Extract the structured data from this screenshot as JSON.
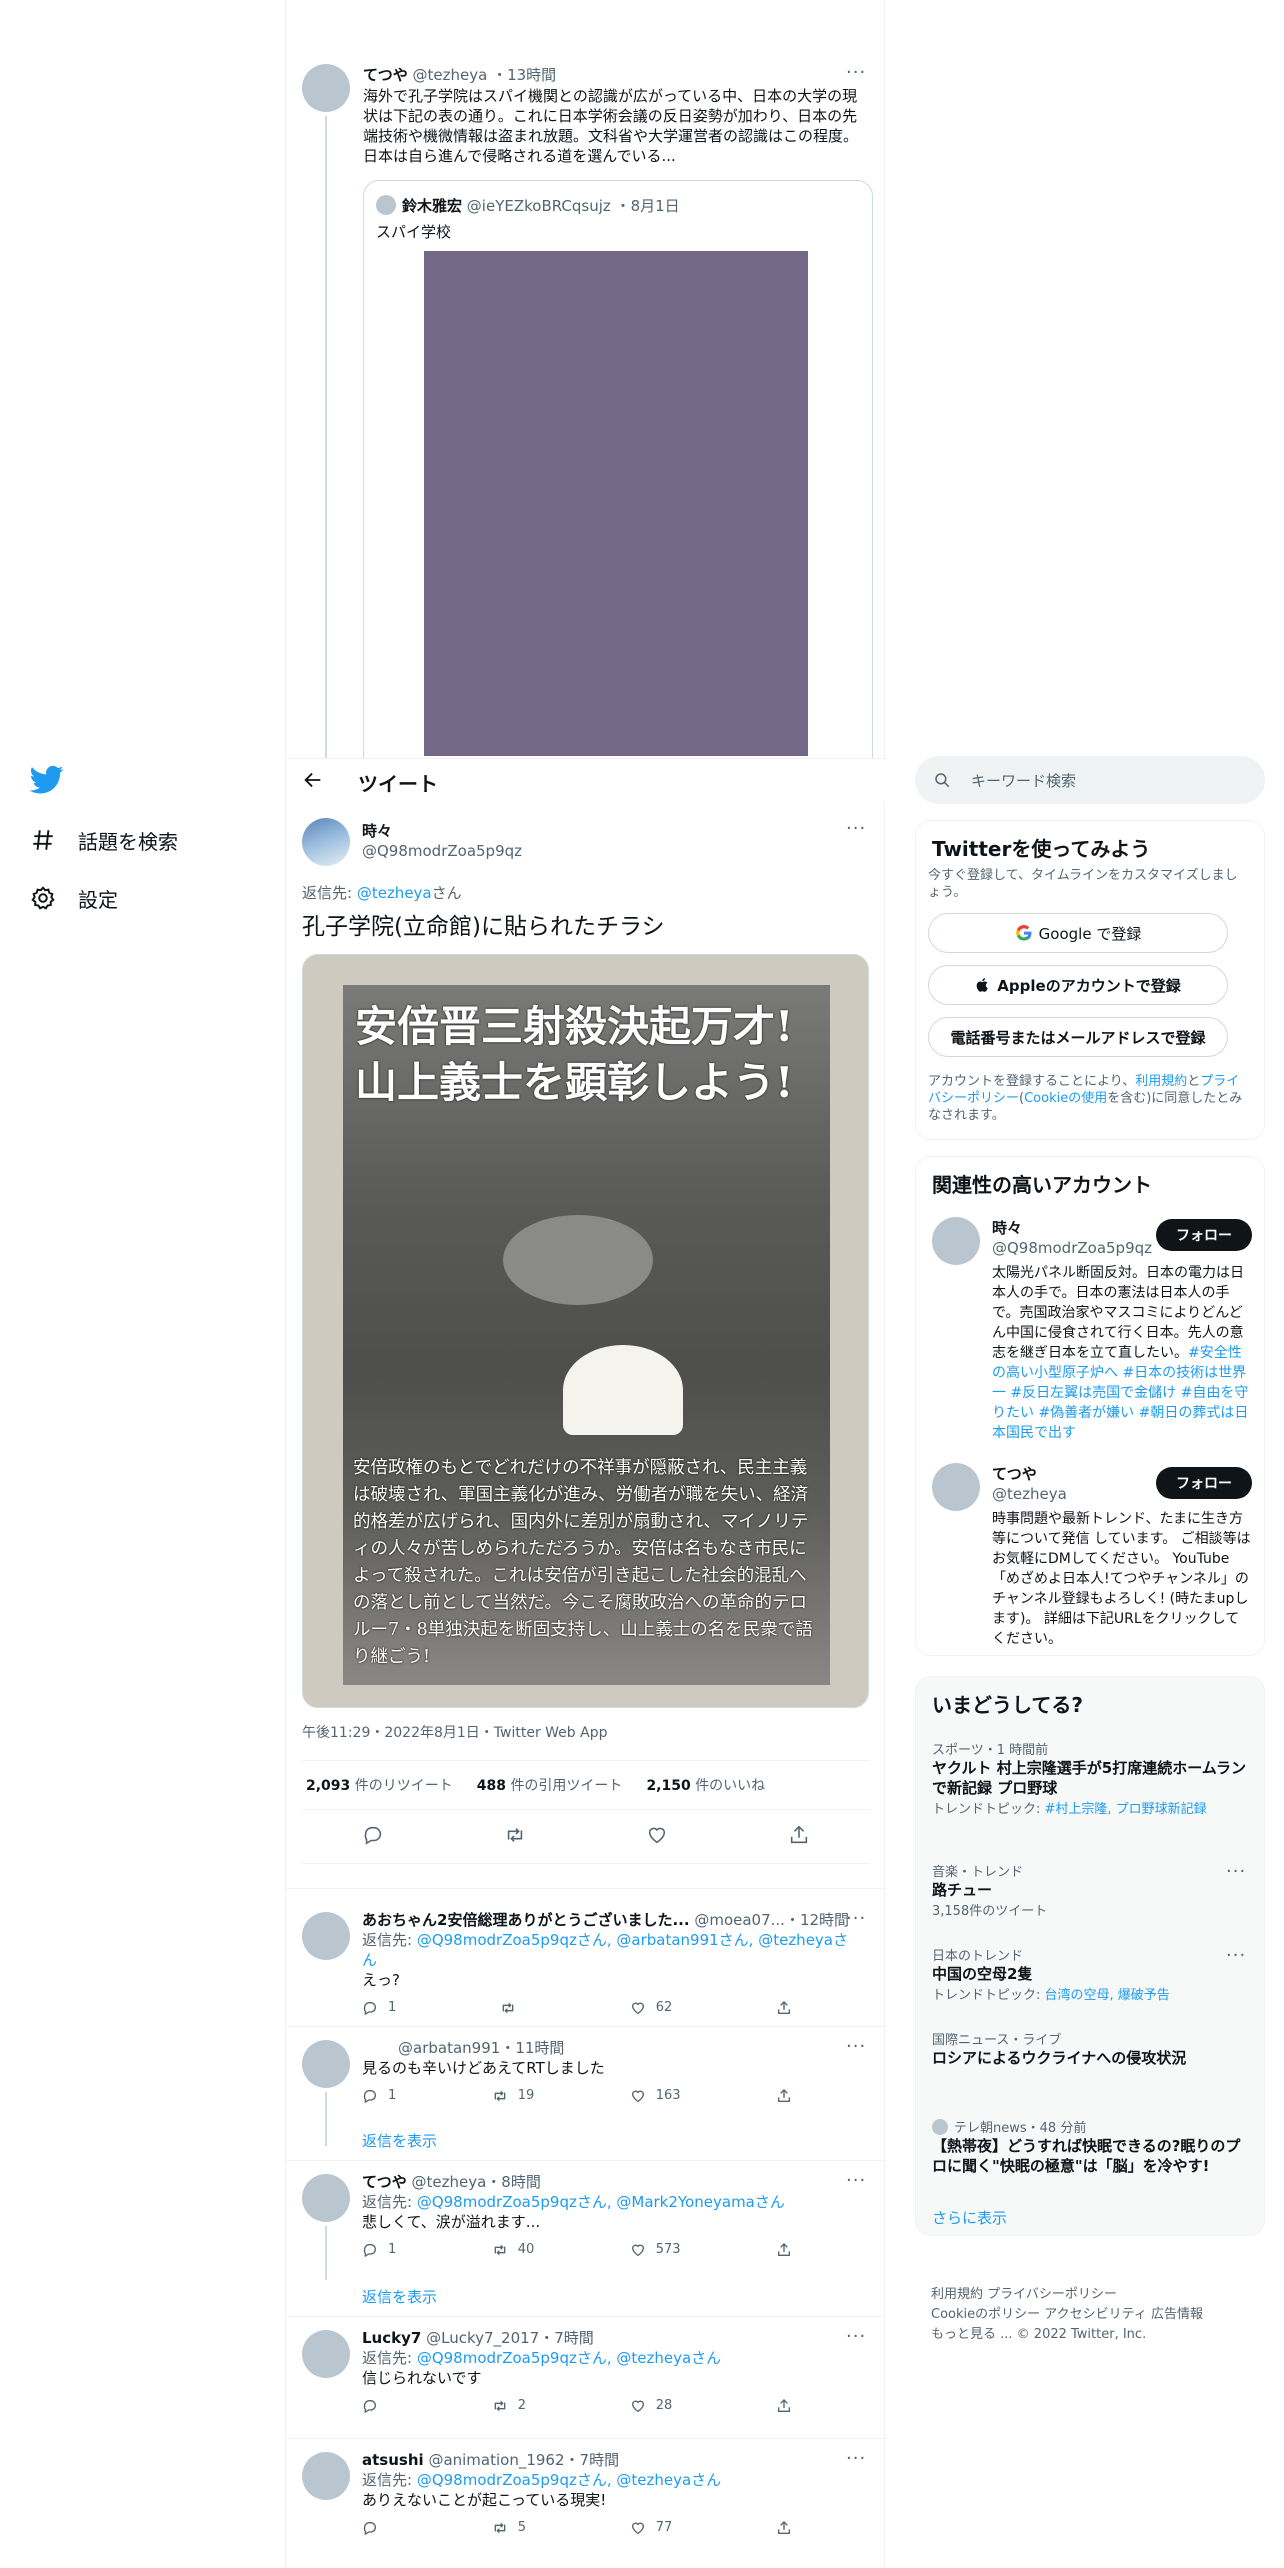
{
  "nav": {
    "explore_label": "話題を検索",
    "settings_label": "設定"
  },
  "top_tweet": {
    "name": "てつや",
    "handle": "@tezheya",
    "time": "13時間",
    "text": "海外で孔子学院はスパイ機関との認識が広がっている中、日本の大学の現状は下記の表の通り。これに日本学術会議の反日姿勢が加わり、日本の先端技術や機微情報は盗まれ放題。文科省や大学運営者の認識はこの程度。日本は自ら進んで侵略される道を選んでいる...",
    "quote": {
      "name": "鈴木雅宏",
      "handle": "@ieYEZkoBRCqsujz",
      "date": "8月1日",
      "text": "スパイ学校"
    }
  },
  "header": {
    "title": "ツイート"
  },
  "main_tweet": {
    "name": "時々",
    "handle": "@Q98modrZoa5p9qz",
    "reply_to_prefix": "返信先: ",
    "reply_to_handle": "@tezheya",
    "reply_to_suffix": "さん",
    "text": "孔子学院(立命館)に貼られたチラシ",
    "poster_headline_1": "安倍晋三射殺決起万才!",
    "poster_headline_2": "山上義士を顕彰しよう!",
    "poster_body": "安倍政権のもとでどれだけの不祥事が隠蔽され、民主主義は破壊され、軍国主義化が進み、労働者が職を失い、経済的格差が広げられ、国内外に差別が扇動され、マイノリティの人々が苦しめられただろうか。安倍は名もなき市民によって殺された。これは安倍が引き起こした社会的混乱への落とし前として当然だ。今こそ腐敗政治への革命的テロルー7・8単独決起を断固支持し、山上義士の名を民衆で語り継ごう!",
    "timestamp": "午後11:29・2022年8月1日・Twitter Web App",
    "retweets_count": "2,093",
    "retweets_label": "件のリツイート",
    "quotes_count": "488",
    "quotes_label": "件の引用ツイート",
    "likes_count": "2,150",
    "likes_label": "件のいいね"
  },
  "replies": [
    {
      "name": "あおちゃん2安倍総理ありがとうございました...",
      "handle": "@moea07...",
      "time": "12時間",
      "reply_prefix": "返信先: ",
      "reply_handles": "@Q98modrZoa5p9qzさん, @arbatan991さん, @tezheyaさん",
      "text": "えっ?",
      "replies": "1",
      "retweets": "",
      "likes": "62"
    },
    {
      "name": "",
      "handle": "@arbatan991",
      "time": "11時間",
      "reply_prefix": "",
      "reply_handles": "",
      "text": "見るのも辛いけどあえてRTしました",
      "replies": "1",
      "retweets": "19",
      "likes": "163"
    },
    {
      "name": "てつや",
      "handle": "@tezheya",
      "time": "8時間",
      "reply_prefix": "返信先: ",
      "reply_handles": "@Q98modrZoa5p9qzさん, @Mark2Yoneyamaさん",
      "text": "悲しくて、涙が溢れます...",
      "replies": "1",
      "retweets": "40",
      "likes": "573"
    },
    {
      "name": "Lucky7",
      "handle": "@Lucky7_2017",
      "time": "7時間",
      "reply_prefix": "返信先: ",
      "reply_handles": "@Q98modrZoa5p9qzさん, @tezheyaさん",
      "text": "信じられないです",
      "replies": "",
      "retweets": "2",
      "likes": "28"
    },
    {
      "name": "atsushi",
      "handle": "@animation_1962",
      "time": "7時間",
      "reply_prefix": "返信先: ",
      "reply_handles": "@Q98modrZoa5p9qzさん, @tezheyaさん",
      "text": "ありえないことが起こっている現実!",
      "replies": "",
      "retweets": "5",
      "likes": "77"
    }
  ],
  "show_replies_label": "返信を表示",
  "search": {
    "placeholder": "キーワード検索"
  },
  "signup": {
    "title": "Twitterを使ってみよう",
    "subtitle": "今すぐ登録して、タイムラインをカスタマイズしましょう。",
    "google_label": "Google で登録",
    "apple_label": "Appleのアカウントで登録",
    "phone_label": "電話番号またはメールアドレスで登録",
    "terms_1": "アカウントを登録することにより、",
    "terms_link_1": "利用規約",
    "terms_2": "と",
    "terms_link_2": "プライバシーポリシー",
    "terms_3": "(",
    "terms_link_3": "Cookieの使用",
    "terms_4": "を含む)に同意したとみなされます。"
  },
  "related": {
    "title": "関連性の高いアカウント",
    "follow_label": "フォロー",
    "accounts": [
      {
        "name": "時々",
        "handle": "@Q98modrZoa5p9qz",
        "bio": "太陽光パネル断固反対。日本の電力は日本人の手で。日本の憲法は日本人の手で。売国政治家やマスコミによりどんどん中国に侵食されて行く日本。先人の意志を継ぎ日本を立て直したい。",
        "hashtags": "#安全性の高い小型原子炉へ #日本の技術は世界一 #反日左翼は売国で金儲け #自由を守りたい #偽善者が嫌い #朝日の葬式は日本国民で出す"
      },
      {
        "name": "てつや",
        "handle": "@tezheya",
        "bio": "時事問題や最新トレンド、たまに生き方等について発信 しています。 ご相談等はお気軽にDMしてください。 YouTube「めざめよ日本人!てつやチャンネル」のチャンネル登録もよろしく! (時たまupします)。 詳細は下記URLをクリックしてください。",
        "hashtags": ""
      }
    ]
  },
  "trends": {
    "title": "いまどうしてる?",
    "items": [
      {
        "meta": "スポーツ・1 時間前",
        "title": "ヤクルト 村上宗隆選手が5打席連続ホームランで新記録 プロ野球",
        "sub_prefix": "トレンドトピック: ",
        "sub_links": "#村上宗隆, プロ野球新記録",
        "sub": ""
      },
      {
        "meta": "音楽・トレンド",
        "title": "路チュー",
        "sub_prefix": "",
        "sub_links": "",
        "sub": "3,158件のツイート"
      },
      {
        "meta": "日本のトレンド",
        "title": "中国の空母2隻",
        "sub_prefix": "トレンドトピック: ",
        "sub_links": "台湾の空母, 爆破予告",
        "sub": ""
      },
      {
        "meta": "国際ニュース・ライブ",
        "title": "ロシアによるウクライナへの侵攻状況",
        "sub_prefix": "",
        "sub_links": "",
        "sub": ""
      },
      {
        "meta": "テレ朝news・48 分前",
        "title": "【熱帯夜】どうすれば快眠できるの?眠りのプロに聞く\"快眠の極意\"は「脳」を冷やす!",
        "sub_prefix": "",
        "sub_links": "",
        "sub": ""
      }
    ],
    "show_more": "さらに表示"
  },
  "footer": {
    "links_1": "利用規約 プライバシーポリシー",
    "links_2": "Cookieのポリシー アクセシビリティ 広告情報",
    "links_3": "もっと見る ... © 2022 Twitter, Inc."
  },
  "colors": {
    "accent": "#1d9bf0",
    "text": "#0f1419",
    "muted": "#536471"
  }
}
